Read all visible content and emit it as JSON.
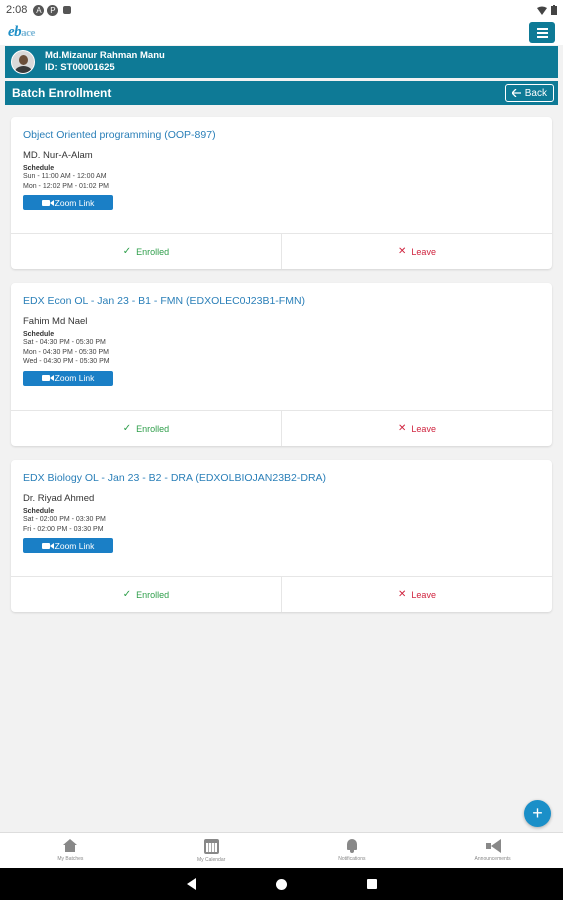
{
  "status": {
    "time": "2:08",
    "icons": [
      "notification-a-icon",
      "notification-p-icon",
      "notification-square-icon"
    ],
    "right_icons": [
      "wifi-icon",
      "battery-icon"
    ]
  },
  "header": {
    "logo_main": "eb",
    "logo_sub": "ace",
    "menu_icon": "hamburger-menu-icon"
  },
  "profile": {
    "name": "Md.Mizanur Rahman Manu",
    "id": "ID: ST00001625"
  },
  "page": {
    "title": "Batch Enrollment",
    "back_label": "Back"
  },
  "courses": [
    {
      "title": "Object Oriented programming (OOP-897)",
      "instructor": "MD. Nur-A-Alam",
      "schedule_label": "Schedule",
      "schedule": [
        "Sun - 11:00 AM - 12:00 AM",
        "Mon - 12:02 PM - 01:02 PM"
      ],
      "zoom_label": "Zoom Link",
      "enrolled_label": "Enrolled",
      "leave_label": "Leave"
    },
    {
      "title": "EDX Econ OL - Jan 23 - B1 - FMN (EDXOLEC0J23B1-FMN)",
      "instructor": "Fahim Md Nael",
      "schedule_label": "Schedule",
      "schedule": [
        "Sat - 04:30 PM - 05:30 PM",
        "Mon - 04:30 PM - 05:30 PM",
        "Wed - 04:30 PM - 05:30 PM"
      ],
      "zoom_label": "Zoom Link",
      "enrolled_label": "Enrolled",
      "leave_label": "Leave"
    },
    {
      "title": "EDX Biology OL - Jan 23 - B2 - DRA (EDXOLBIOJAN23B2-DRA)",
      "instructor": "Dr. Riyad Ahmed",
      "schedule_label": "Schedule",
      "schedule": [
        "Sat - 02:00 PM - 03:30 PM",
        "Fri - 02:00 PM - 03:30 PM"
      ],
      "zoom_label": "Zoom Link",
      "enrolled_label": "Enrolled",
      "leave_label": "Leave"
    }
  ],
  "fab": {
    "label": "+"
  },
  "bottom_nav": [
    {
      "label": "My Batches",
      "icon": "home-icon"
    },
    {
      "label": "My Calendar",
      "icon": "calendar-icon"
    },
    {
      "label": "Notifications",
      "icon": "bell-icon"
    },
    {
      "label": "Announcements",
      "icon": "megaphone-icon"
    }
  ],
  "colors": {
    "primary": "#0e7a96",
    "link": "#2a7fb8",
    "zoom": "#1a7fc6",
    "enrolled": "#2e9e4a",
    "leave": "#d0243f"
  }
}
